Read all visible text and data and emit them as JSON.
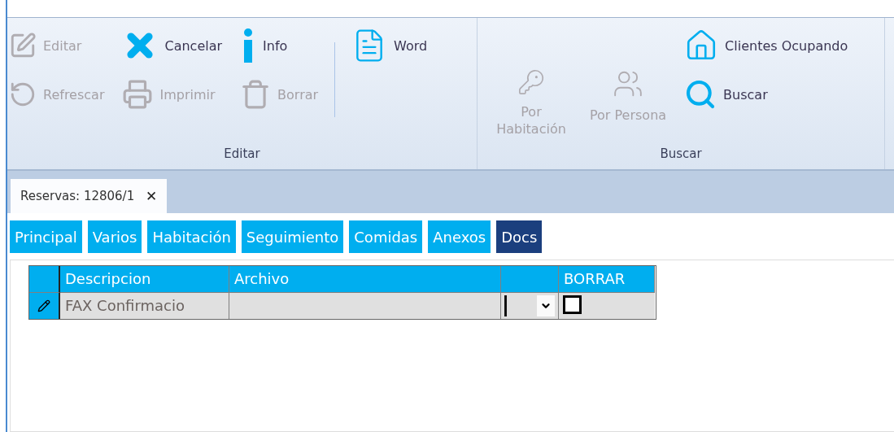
{
  "ribbon": {
    "groups": [
      {
        "label": "Editar",
        "columns": [
          [
            {
              "label": "Editar",
              "disabled": true
            },
            {
              "label": "Refrescar",
              "disabled": true
            }
          ],
          [
            {
              "label": "Cancelar",
              "disabled": false
            },
            {
              "label": "Imprimir",
              "disabled": true
            }
          ],
          [
            {
              "label": "Info",
              "disabled": false
            },
            {
              "label": "Borrar",
              "disabled": true
            }
          ],
          [
            {
              "label": "Word",
              "disabled": false
            }
          ]
        ]
      },
      {
        "label": "Buscar",
        "columns": [
          [
            {
              "label": "Por Habitación",
              "disabled": true,
              "kind": "large"
            }
          ],
          [
            {
              "label": "Por Persona",
              "disabled": true,
              "kind": "large"
            }
          ],
          [
            {
              "label": "Clientes Ocupando",
              "disabled": false
            },
            {
              "label": "Buscar",
              "disabled": false
            }
          ]
        ]
      }
    ]
  },
  "document_tab": {
    "title": "Reservas: 12806/1",
    "close": "✕"
  },
  "tabs": [
    {
      "label": "Principal",
      "selected": false
    },
    {
      "label": "Varios",
      "selected": false
    },
    {
      "label": "Habitación",
      "selected": false
    },
    {
      "label": "Seguimiento",
      "selected": false
    },
    {
      "label": "Comidas",
      "selected": false
    },
    {
      "label": "Anexos",
      "selected": false
    },
    {
      "label": "Docs",
      "selected": true
    }
  ],
  "grid": {
    "columns": [
      {
        "label": "Descripcion"
      },
      {
        "label": "Archivo"
      },
      {},
      {
        "label": "BORRAR"
      }
    ],
    "rows": [
      {
        "editing": true,
        "descripcion": "FAX Confirmacio",
        "borrar": false
      }
    ]
  }
}
